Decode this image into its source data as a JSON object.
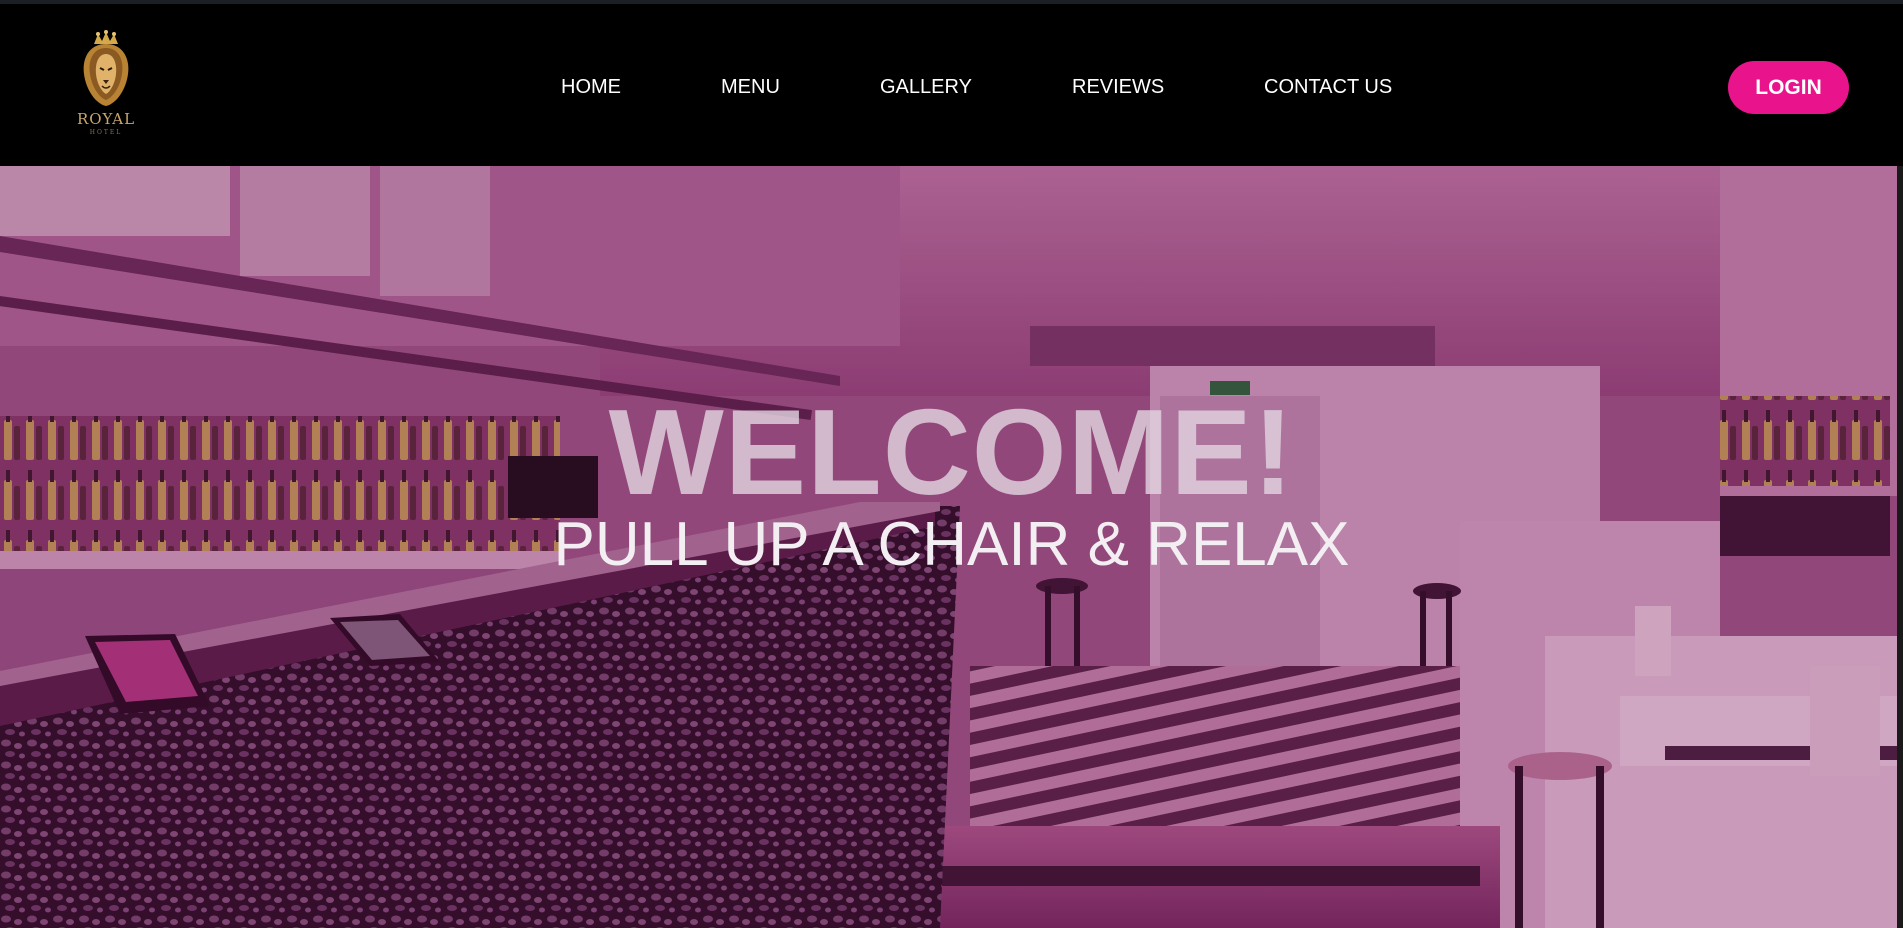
{
  "logo": {
    "name": "ROYAL",
    "subtitle": "HOTEL",
    "icon": "crowned-lion-icon"
  },
  "nav": {
    "items": [
      {
        "label": "HOME"
      },
      {
        "label": "MENU"
      },
      {
        "label": "GALLERY"
      },
      {
        "label": "REVIEWS"
      },
      {
        "label": "CONTACT US"
      }
    ],
    "login_label": "LOGIN"
  },
  "hero": {
    "title": "WELCOME!",
    "subtitle": "PULL UP A CHAIR & RELAX"
  },
  "colors": {
    "header_bg": "#000000",
    "accent": "#e9148c",
    "logo_gold": "#c9a66b"
  }
}
